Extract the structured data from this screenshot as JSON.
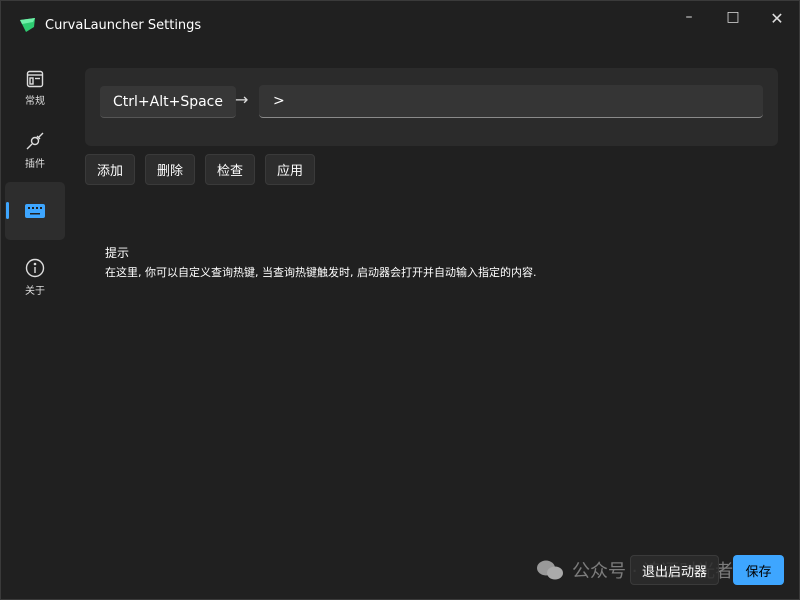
{
  "window": {
    "title": "CurvaLauncher Settings",
    "brand_color": "#2ecc71"
  },
  "nav": [
    {
      "label": "常规",
      "icon": "layout-icon"
    },
    {
      "label": "插件",
      "icon": "plug-icon"
    },
    {
      "label": "",
      "icon": "keyboard-icon",
      "active": true
    },
    {
      "label": "关于",
      "icon": "info-icon"
    }
  ],
  "hotkey": {
    "key": "Ctrl+Alt+Space",
    "query": ">"
  },
  "actions": {
    "add": "添加",
    "delete": "删除",
    "check": "检查",
    "apply": "应用"
  },
  "tip": {
    "title": "提示",
    "text": "在这里, 你可以自定义查询热键, 当查询热键触发时, 启动器会打开并自动输入指定的内容."
  },
  "footer": {
    "exit": "退出启动器",
    "save": "保存",
    "accent": "#3ea6ff"
  },
  "watermark": "公众号 · 追逐时光者"
}
